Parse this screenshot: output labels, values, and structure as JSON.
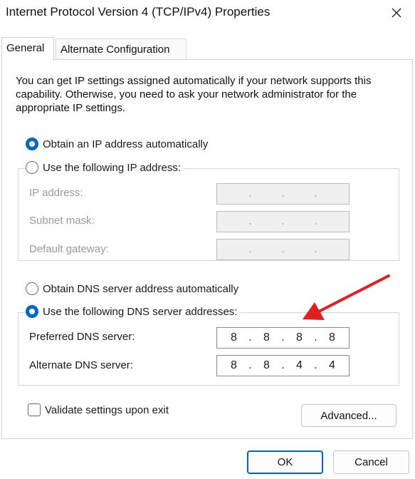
{
  "window": {
    "title": "Internet Protocol Version 4 (TCP/IPv4) Properties"
  },
  "tabs": [
    {
      "label": "General",
      "selected": true
    },
    {
      "label": "Alternate Configuration",
      "selected": false
    }
  ],
  "intro_text": "You can get IP settings assigned automatically if your network supports this capability. Otherwise, you need to ask your network administrator for the appropriate IP settings.",
  "ip": {
    "obtain_auto_label": "Obtain an IP address automatically",
    "use_following_label": "Use the following IP address:",
    "selected": "auto",
    "fields": [
      {
        "label": "IP address:",
        "octets": [
          "",
          "",
          "",
          ""
        ],
        "dots": [
          ".",
          ".",
          "."
        ]
      },
      {
        "label": "Subnet mask:",
        "octets": [
          "",
          "",
          "",
          ""
        ],
        "dots": [
          ".",
          ".",
          "."
        ]
      },
      {
        "label": "Default gateway:",
        "octets": [
          "",
          "",
          "",
          ""
        ],
        "dots": [
          ".",
          ".",
          "."
        ]
      }
    ]
  },
  "dns": {
    "obtain_auto_label": "Obtain DNS server address automatically",
    "use_following_label": "Use the following DNS server addresses:",
    "selected": "manual",
    "fields": [
      {
        "label": "Preferred DNS server:",
        "octets": [
          "8",
          "8",
          "8",
          "8"
        ],
        "dots": [
          ".",
          ".",
          "."
        ]
      },
      {
        "label": "Alternate DNS server:",
        "octets": [
          "8",
          "8",
          "4",
          "4"
        ],
        "dots": [
          ".",
          ".",
          "."
        ]
      }
    ]
  },
  "validate": {
    "label": "Validate settings upon exit",
    "checked": false
  },
  "buttons": {
    "advanced": "Advanced...",
    "ok": "OK",
    "cancel": "Cancel"
  },
  "colors": {
    "accent": "#0067c0",
    "annotation_arrow": "#e02020"
  },
  "icons": {
    "close": "close-icon",
    "annotation": "red-arrow-icon"
  }
}
